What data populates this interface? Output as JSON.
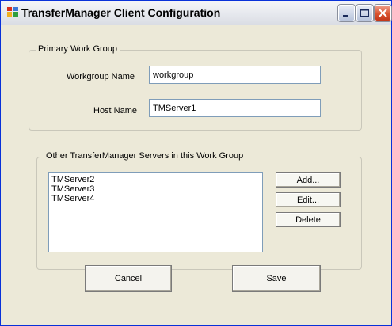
{
  "window": {
    "title": "TransferManager Client Configuration"
  },
  "primary_group": {
    "title": "Primary Work Group",
    "workgroup_label": "Workgroup Name",
    "workgroup_value": "workgroup",
    "host_label": "Host Name",
    "host_value": "TMServer1"
  },
  "servers_group": {
    "title": "Other TransferManager Servers in this Work Group",
    "servers": [
      "TMServer2",
      "TMServer3",
      "TMServer4"
    ],
    "add_label": "Add...",
    "edit_label": "Edit...",
    "delete_label": "Delete"
  },
  "footer": {
    "cancel_label": "Cancel",
    "save_label": "Save"
  }
}
